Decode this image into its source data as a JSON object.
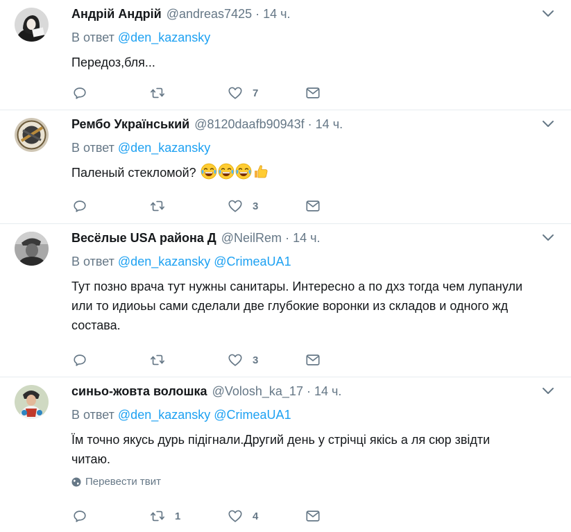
{
  "colors": {
    "link": "#1da1f2",
    "secondary": "#657786",
    "text": "#14171a",
    "divider": "#e6ecf0"
  },
  "reply_prefix": "В ответ",
  "translate_label": "Перевести твит",
  "tweets": [
    {
      "name": "Андрій Андрій",
      "handle": "@andreas7425",
      "dot": "·",
      "time": "14 ч.",
      "mentions": [
        "@den_kazansky"
      ],
      "text": "Передоз,бля...",
      "emoji": [],
      "reply_count": "",
      "retweet_count": "",
      "like_count": "7"
    },
    {
      "name": "Рембо Український",
      "handle": "@8120daafb90943f",
      "dot": "·",
      "time": "14 ч.",
      "mentions": [
        "@den_kazansky"
      ],
      "text": "Паленый стекломой?",
      "emoji": [
        "face-with-tears-of-joy",
        "face-with-tears-of-joy",
        "face-with-tears-of-joy",
        "thumbs-up"
      ],
      "reply_count": "",
      "retweet_count": "",
      "like_count": "3"
    },
    {
      "name": "Весёлые USA района Д",
      "handle": "@NeilRem",
      "dot": "·",
      "time": "14 ч.",
      "mentions": [
        "@den_kazansky",
        "@CrimeaUA1"
      ],
      "text_lines": [
        "Тут позно врача тут нужны санитары. Интересно а по дхз тогда чем лупанули",
        "или то идиоьы сами сделали две глубокие воронки из складов и одного жд",
        "состава."
      ],
      "reply_count": "",
      "retweet_count": "",
      "like_count": "3"
    },
    {
      "name": "синьо-жовта волошка",
      "handle": "@Volosh_ka_17",
      "dot": "·",
      "time": "14 ч.",
      "mentions": [
        "@den_kazansky",
        "@CrimeaUA1"
      ],
      "text_lines": [
        "Їм точно якусь дурь підігнали.Другий день у стрічці якісь а ля сюр звідти",
        "читаю."
      ],
      "reply_count": "",
      "retweet_count": "1",
      "like_count": "4"
    }
  ]
}
